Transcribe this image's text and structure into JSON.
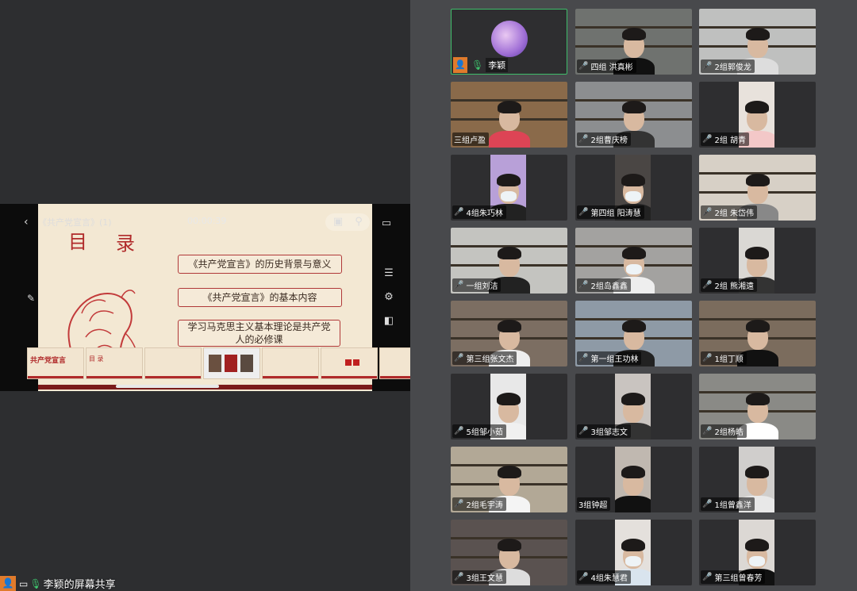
{
  "share": {
    "doc_title": "《共产党宣言》(1)",
    "timer": "00:00:39",
    "slide": {
      "heading_1": "目",
      "heading_2": "录",
      "items": [
        "《共产党宣言》的历史背景与意义",
        "《共产党宣言》的基本内容",
        "学习马克思主义基本理论是共产党人的必修课"
      ]
    },
    "thumbnails": [
      "共产党宣言",
      "目 录",
      "",
      "",
      "",
      "",
      ""
    ],
    "thumb_numbers": [
      "1",
      "2",
      "3",
      "4",
      "5",
      "6",
      ""
    ],
    "sharer_label": "李颖的屏幕共享"
  },
  "icons": {
    "back": "back-arrow-icon",
    "camera": "camera-switch-icon",
    "person": "person-settings-icon",
    "cast": "cast-screen-icon",
    "notes": "notes-icon",
    "settings": "gear-icon",
    "layout": "layout-icon",
    "pencil": "pencil-icon",
    "mic_muted": "mic-muted-icon",
    "mic_on": "mic-on-icon"
  },
  "colors": {
    "active_border": "#3ebd6a",
    "mic_muted": "#e24b4b",
    "avatar_orange": "#e07b2c",
    "slide_red": "#b02a2a"
  },
  "participants": [
    {
      "name": "李颖",
      "self": true,
      "muted": false
    },
    {
      "name": "四组 洪真彬",
      "muted": true
    },
    {
      "name": "2组郭俊龙",
      "muted": true
    },
    {
      "name": "三组卢盈",
      "muted": false
    },
    {
      "name": "2组曹庆榜",
      "muted": true
    },
    {
      "name": "2组  胡青",
      "muted": true
    },
    {
      "name": "4组朱巧林",
      "muted": true
    },
    {
      "name": "第四组 阳涛慧",
      "muted": true
    },
    {
      "name": "2组 朱岱伟",
      "muted": true
    },
    {
      "name": "一组刘洁",
      "muted": true
    },
    {
      "name": "2组岛鑫鑫",
      "muted": true
    },
    {
      "name": "2组 熊湘遠",
      "muted": true
    },
    {
      "name": "第三组张文杰",
      "muted": true
    },
    {
      "name": "第一组王功林",
      "muted": true
    },
    {
      "name": "1组丁顺",
      "muted": true
    },
    {
      "name": "5组邹小茹",
      "muted": true
    },
    {
      "name": "3组邹志文",
      "muted": true
    },
    {
      "name": "2组杨皓",
      "muted": true
    },
    {
      "name": "2组毛宇涛",
      "muted": true
    },
    {
      "name": "3组钟超",
      "muted": false
    },
    {
      "name": "1组曾鑫洋",
      "muted": true
    },
    {
      "name": "3组王文慧",
      "muted": true
    },
    {
      "name": "4组朱慧君",
      "muted": true
    },
    {
      "name": "第三组曾春芳",
      "muted": true
    }
  ]
}
